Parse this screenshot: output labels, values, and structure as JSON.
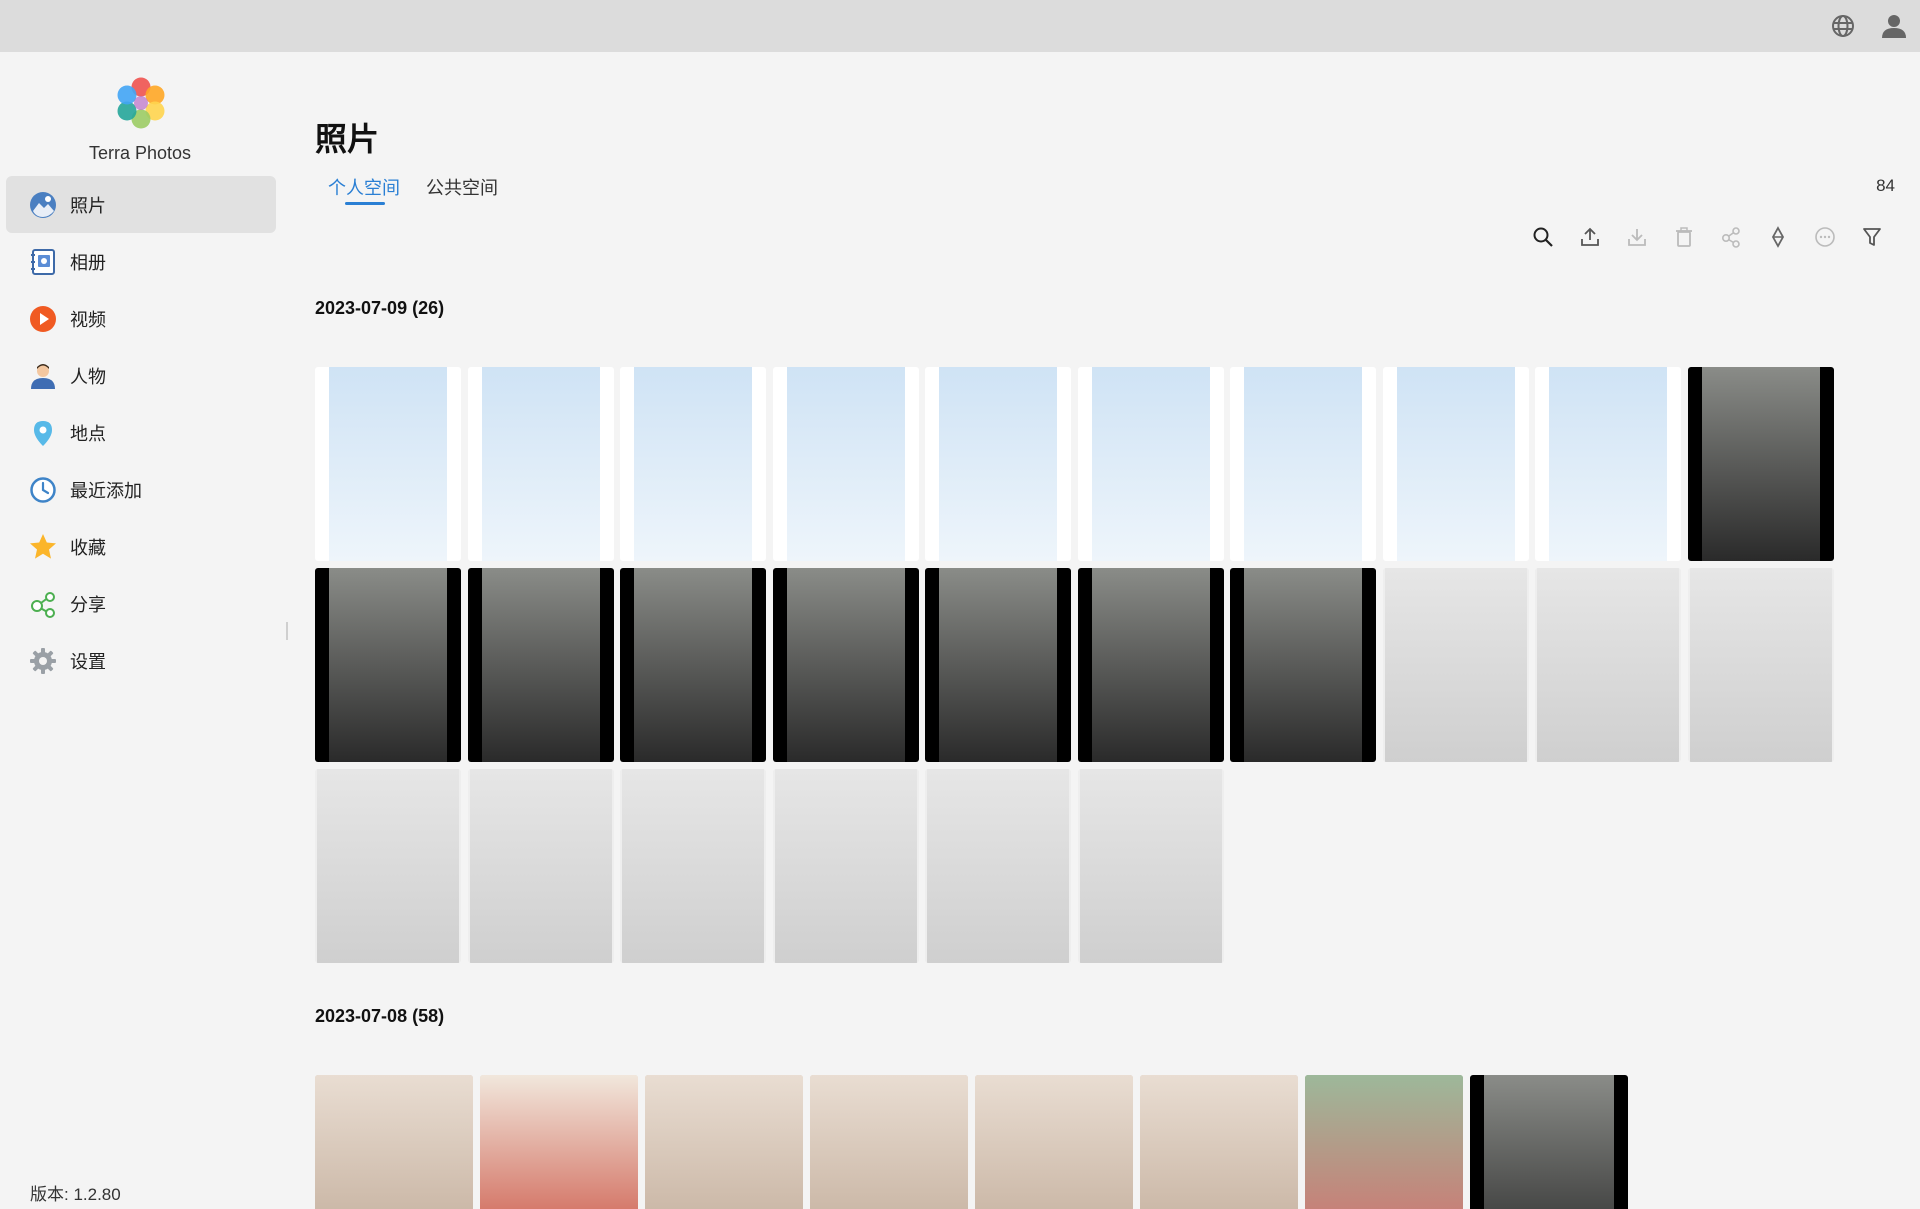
{
  "app": {
    "name": "Terra Photos",
    "version": "版本: 1.2.80"
  },
  "topbar": {
    "icons": [
      "globe-icon",
      "user-icon"
    ]
  },
  "sidebar": {
    "items": [
      {
        "label": "照片",
        "icon": "photos-icon",
        "active": true
      },
      {
        "label": "相册",
        "icon": "album-icon"
      },
      {
        "label": "视频",
        "icon": "video-icon"
      },
      {
        "label": "人物",
        "icon": "people-icon"
      },
      {
        "label": "地点",
        "icon": "location-icon"
      },
      {
        "label": "最近添加",
        "icon": "clock-icon"
      },
      {
        "label": "收藏",
        "icon": "star-icon"
      },
      {
        "label": "分享",
        "icon": "share-icon"
      },
      {
        "label": "设置",
        "icon": "gear-icon"
      }
    ]
  },
  "main": {
    "title": "照片",
    "tabs": [
      {
        "label": "个人空间",
        "active": true
      },
      {
        "label": "公共空间"
      }
    ],
    "count": "84",
    "toolbar": [
      "search-icon",
      "upload-icon",
      "download-icon",
      "trash-icon",
      "share-icon",
      "diamond-icon",
      "more-icon",
      "filter-icon"
    ],
    "groups": [
      {
        "date": "2023-07-09 (26)",
        "photos": [
          "light",
          "light",
          "light",
          "light",
          "light",
          "light",
          "light",
          "light",
          "light",
          "dark",
          "dark",
          "dark",
          "dark",
          "dark",
          "dark",
          "dark",
          "dark",
          "grey",
          "grey",
          "grey",
          "grey",
          "grey",
          "grey",
          "grey",
          "grey",
          "grey"
        ]
      },
      {
        "date": "2023-07-08 (58)",
        "photos": [
          "warm",
          "red",
          "warm",
          "warm",
          "warm",
          "warm",
          "green",
          "dark"
        ]
      }
    ]
  },
  "colors": {
    "accent": "#2a7fd4",
    "topbar": "#dcdcdc",
    "sidebar_active": "#e1e1e1"
  }
}
